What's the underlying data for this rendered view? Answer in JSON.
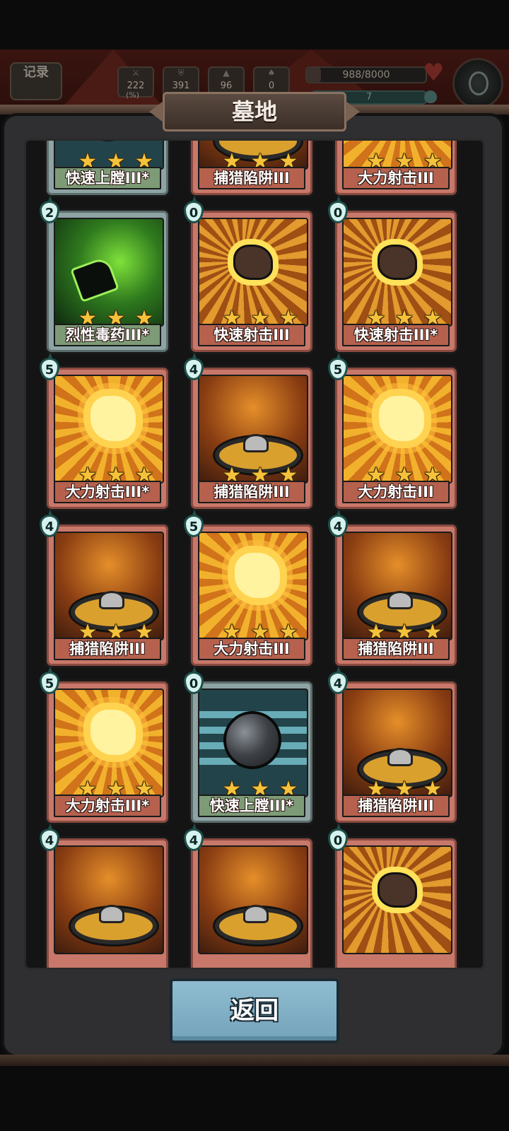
{
  "hud": {
    "record_label": "记录",
    "record_sub": "",
    "stats": [
      {
        "icon": "sword-icon",
        "value": "222"
      },
      {
        "icon": "shield-icon",
        "value": "391"
      },
      {
        "icon": "helmet-icon",
        "value": "96"
      },
      {
        "icon": "boot-icon",
        "value": "0"
      }
    ],
    "stat_pct": "(%)",
    "hp": "988/8000",
    "hp_fraction": 0.12,
    "xp": "7"
  },
  "panel": {
    "title": "墓地"
  },
  "cards": [
    {
      "name": "快速上膛III*",
      "cost": "",
      "art": "reload",
      "frame": "tech",
      "stars": 3
    },
    {
      "name": "捕猎陷阱III",
      "cost": "",
      "art": "trap",
      "frame": "fire",
      "stars": 3
    },
    {
      "name": "大力射击III",
      "cost": "",
      "art": "shot",
      "frame": "fire",
      "stars": 3
    },
    {
      "name": "烈性毒药III*",
      "cost": "2",
      "art": "poison",
      "frame": "tech",
      "stars": 3
    },
    {
      "name": "快速射击III",
      "cost": "0",
      "art": "rock",
      "frame": "fire",
      "stars": 3
    },
    {
      "name": "快速射击III*",
      "cost": "0",
      "art": "rock",
      "frame": "fire",
      "stars": 3
    },
    {
      "name": "大力射击III*",
      "cost": "5",
      "art": "shot",
      "frame": "fire",
      "stars": 3
    },
    {
      "name": "捕猎陷阱III",
      "cost": "4",
      "art": "trap",
      "frame": "fire",
      "stars": 3
    },
    {
      "name": "大力射击III",
      "cost": "5",
      "art": "shot",
      "frame": "fire",
      "stars": 3
    },
    {
      "name": "捕猎陷阱III",
      "cost": "4",
      "art": "trap",
      "frame": "fire",
      "stars": 3
    },
    {
      "name": "大力射击III",
      "cost": "5",
      "art": "shot",
      "frame": "fire",
      "stars": 3
    },
    {
      "name": "捕猎陷阱III",
      "cost": "4",
      "art": "trap",
      "frame": "fire",
      "stars": 3
    },
    {
      "name": "大力射击III*",
      "cost": "5",
      "art": "shot",
      "frame": "fire",
      "stars": 3
    },
    {
      "name": "快速上膛III*",
      "cost": "0",
      "art": "reload",
      "frame": "tech",
      "stars": 3
    },
    {
      "name": "捕猎陷阱III",
      "cost": "4",
      "art": "trap",
      "frame": "fire",
      "stars": 3
    },
    {
      "name": "",
      "cost": "4",
      "art": "trap",
      "frame": "fire",
      "stars": 0
    },
    {
      "name": "",
      "cost": "4",
      "art": "trap",
      "frame": "fire",
      "stars": 0
    },
    {
      "name": "",
      "cost": "0",
      "art": "rock",
      "frame": "fire",
      "stars": 0
    }
  ],
  "actions": {
    "return_label": "返回"
  },
  "colors": {
    "panel_bg": "#2f2f31",
    "star": "#f6c23a",
    "return_button": "#8fbcd0",
    "cost_badge": "#d6f2ef"
  }
}
